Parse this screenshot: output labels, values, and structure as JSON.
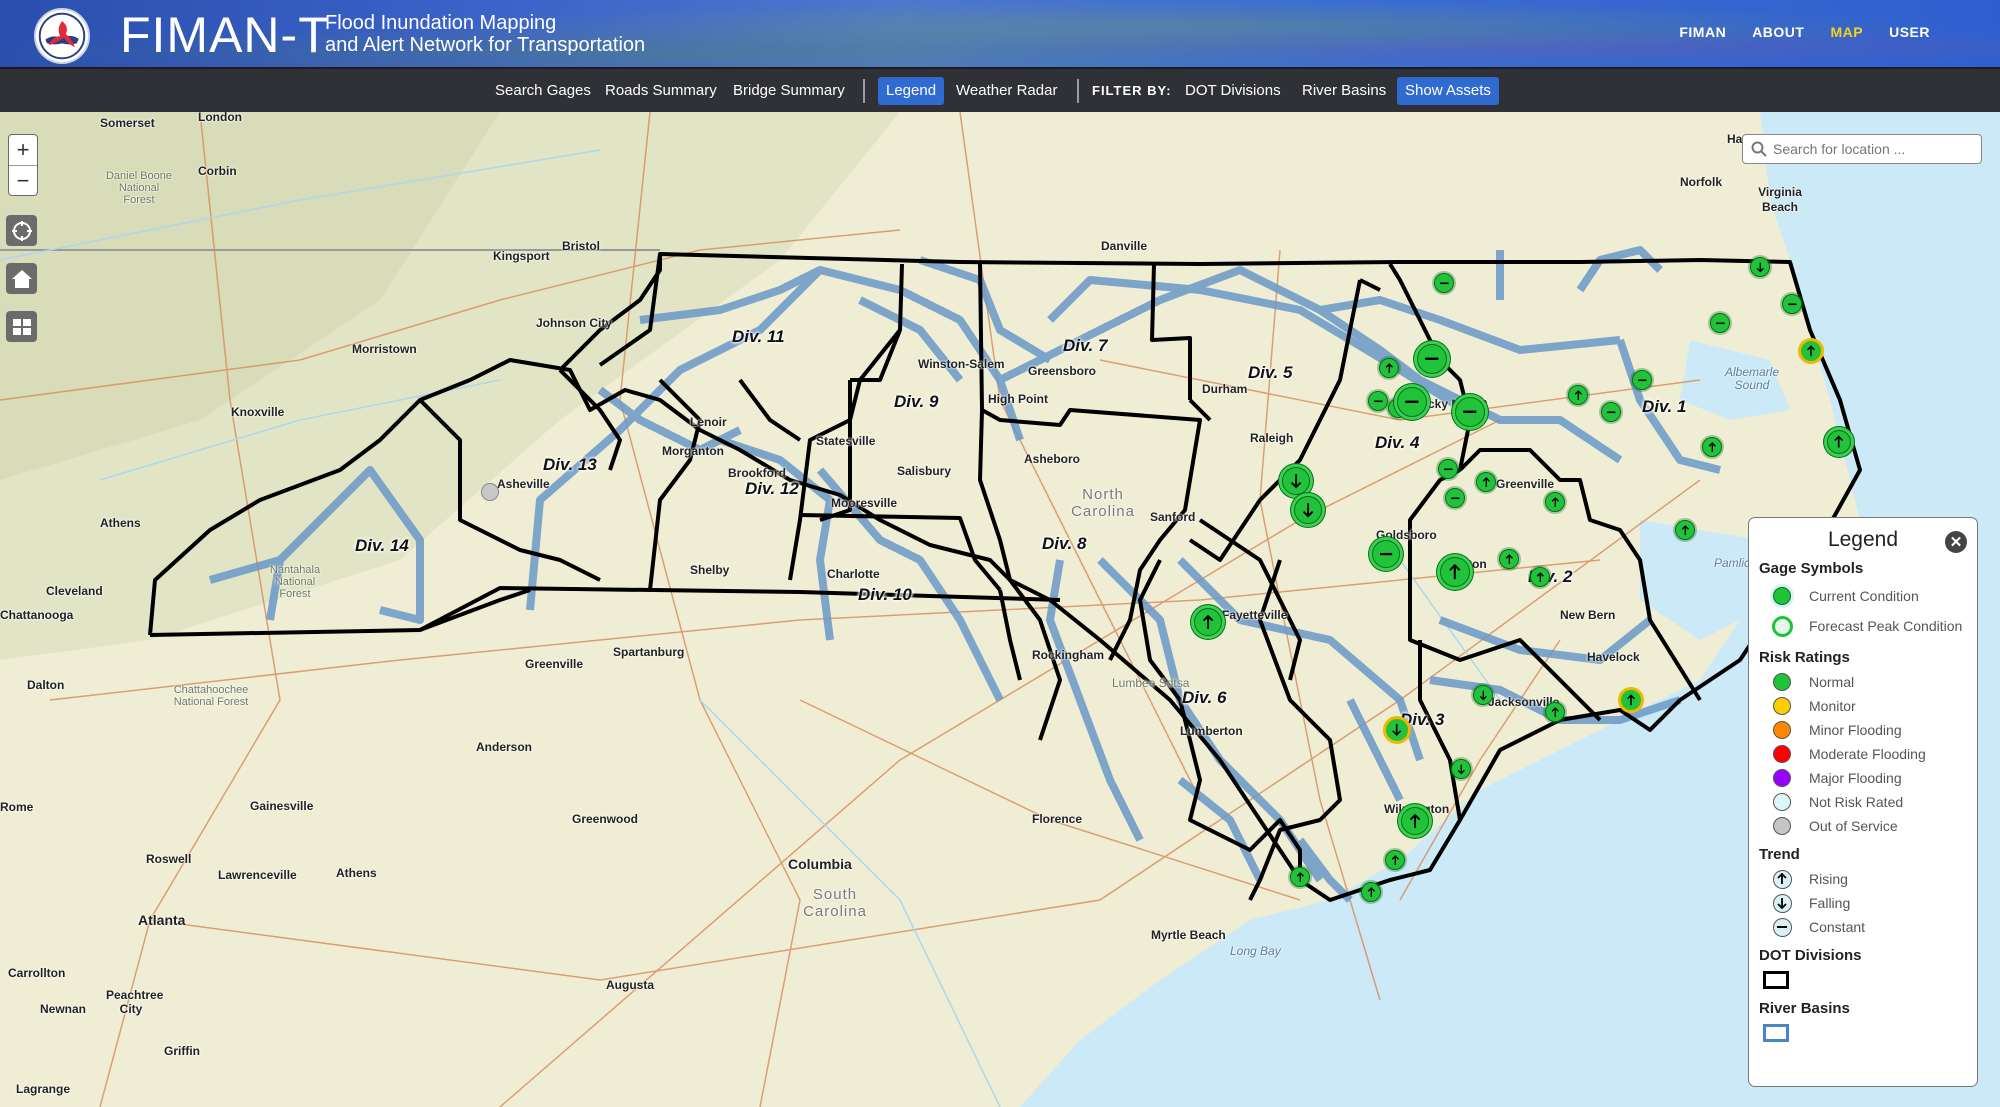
{
  "header": {
    "brand": "FIMAN-T",
    "subtitle_line1": "Flood Inundation Mapping",
    "subtitle_line2": "and Alert Network for Transportation",
    "nav": [
      {
        "label": "FIMAN",
        "active": false
      },
      {
        "label": "ABOUT",
        "active": false
      },
      {
        "label": "MAP",
        "active": true
      },
      {
        "label": "USER",
        "active": false
      }
    ]
  },
  "toolbar": {
    "search_gages": "Search Gages",
    "roads_summary": "Roads Summary",
    "bridge_summary": "Bridge Summary",
    "legend": "Legend",
    "weather_radar": "Weather Radar",
    "filter_by": "FILTER BY:",
    "dot_divisions": "DOT Divisions",
    "river_basins": "River Basins",
    "show_assets": "Show Assets"
  },
  "map_controls": {
    "zoom_in": "+",
    "zoom_out": "−"
  },
  "search": {
    "placeholder": "Search for location ..."
  },
  "legend": {
    "title": "Legend",
    "gage_symbols_title": "Gage Symbols",
    "gage_symbols": [
      "Current Condition",
      "Forecast Peak Condition"
    ],
    "risk_ratings_title": "Risk Ratings",
    "risk_ratings": [
      {
        "label": "Normal",
        "color": "#1ec436"
      },
      {
        "label": "Monitor",
        "color": "#ffcc00"
      },
      {
        "label": "Minor Flooding",
        "color": "#ff8800"
      },
      {
        "label": "Moderate Flooding",
        "color": "#ff0000"
      },
      {
        "label": "Major Flooding",
        "color": "#9900ff"
      },
      {
        "label": "Not Risk Rated",
        "color": "#dcf6fb"
      },
      {
        "label": "Out of Service",
        "color": "#c4c4c4"
      }
    ],
    "trend_title": "Trend",
    "trends": [
      "Rising",
      "Falling",
      "Constant"
    ],
    "dot_divisions_title": "DOT Divisions",
    "river_basins_title": "River Basins"
  },
  "divisions": [
    "Div. 1",
    "Div. 2",
    "Div. 3",
    "Div. 4",
    "Div. 5",
    "Div. 6",
    "Div. 7",
    "Div. 8",
    "Div. 9",
    "Div. 10",
    "Div. 11",
    "Div. 12",
    "Div. 13",
    "Div. 14"
  ],
  "places": {
    "cities": [
      "Somerset",
      "London",
      "Corbin",
      "Bristol",
      "Kingsport",
      "Johnson City",
      "Morristown",
      "Knoxville",
      "Athens",
      "Cleveland",
      "Dalton",
      "Asheville",
      "Lenoir",
      "Morganton",
      "Brookford",
      "Statesville",
      "Salisbury",
      "Mooresville",
      "Shelby",
      "Charlotte",
      "Winston-Salem",
      "Greensboro",
      "High Point",
      "Danville",
      "Asheboro",
      "Durham",
      "Raleigh",
      "Sanford",
      "Fayetteville",
      "Rockingham",
      "Lumberton",
      "Rocky Mount",
      "Goldsboro",
      "Greenville",
      "Kinston",
      "New Bern",
      "Havelock",
      "Jacksonville",
      "Wilmington",
      "Norfolk",
      "Hampton",
      "Virginia Beach",
      "Spartanburg",
      "Anderson",
      "Gainesville",
      "Greenwood",
      "Florence",
      "Columbia",
      "Roswell",
      "Lawrenceville",
      "Atlanta",
      "Carrollton",
      "Peachtree City",
      "Newnan",
      "Griffin",
      "Lagrange",
      "Augusta",
      "Myrtle Beach",
      "Rome",
      "Chattanooga"
    ],
    "greenville_sc": "Greenville",
    "athens_ga": "Athens",
    "forests": [
      "Daniel Boone National Forest",
      "Nantahala National Forest",
      "Chattahoochee National Forest",
      "Lumbee Sdtsa"
    ],
    "water": [
      "Albemarle Sound",
      "Pamlico",
      "Long Bay"
    ],
    "states": [
      "North Carolina",
      "South Carolina"
    ]
  },
  "gages": [
    {
      "trend": "falling",
      "risk": "normal"
    },
    {
      "trend": "constant",
      "risk": "normal"
    },
    {
      "trend": "constant",
      "risk": "normal"
    },
    {
      "trend": "rising",
      "risk": "monitor"
    },
    {
      "trend": "constant",
      "risk": "normal"
    },
    {
      "trend": "rising",
      "risk": "normal"
    },
    {
      "trend": "constant",
      "risk": "normal"
    },
    {
      "trend": "rising",
      "risk": "normal"
    },
    {
      "trend": "rising",
      "risk": "normal"
    },
    {
      "trend": "constant",
      "risk": "normal"
    },
    {
      "trend": "constant",
      "risk": "normal"
    },
    {
      "trend": "rising",
      "risk": "normal"
    },
    {
      "trend": "constant",
      "risk": "normal"
    },
    {
      "trend": "constant",
      "risk": "normal"
    },
    {
      "trend": "constant",
      "risk": "normal"
    },
    {
      "trend": "constant",
      "risk": "normal"
    },
    {
      "trend": "constant",
      "risk": "normal"
    },
    {
      "trend": "falling",
      "risk": "normal"
    },
    {
      "trend": "falling",
      "risk": "normal"
    },
    {
      "trend": "constant",
      "risk": "normal"
    },
    {
      "trend": "constant",
      "risk": "normal"
    },
    {
      "trend": "rising",
      "risk": "normal"
    },
    {
      "trend": "rising",
      "risk": "normal"
    },
    {
      "trend": "rising",
      "risk": "normal"
    },
    {
      "trend": "rising",
      "risk": "normal"
    },
    {
      "trend": "rising",
      "risk": "normal"
    },
    {
      "trend": "rising",
      "risk": "normal"
    },
    {
      "trend": "rising",
      "risk": "normal"
    },
    {
      "trend": "falling",
      "risk": "monitor"
    },
    {
      "trend": "falling",
      "risk": "normal"
    },
    {
      "trend": "rising",
      "risk": "normal"
    },
    {
      "trend": "rising",
      "risk": "monitor"
    },
    {
      "trend": "falling",
      "risk": "normal"
    },
    {
      "trend": "rising",
      "risk": "normal"
    },
    {
      "trend": "rising",
      "risk": "normal"
    },
    {
      "trend": "rising",
      "risk": "normal"
    },
    {
      "trend": "rising",
      "risk": "normal"
    },
    {
      "trend": "out-of-service",
      "risk": "out-of-service"
    }
  ]
}
